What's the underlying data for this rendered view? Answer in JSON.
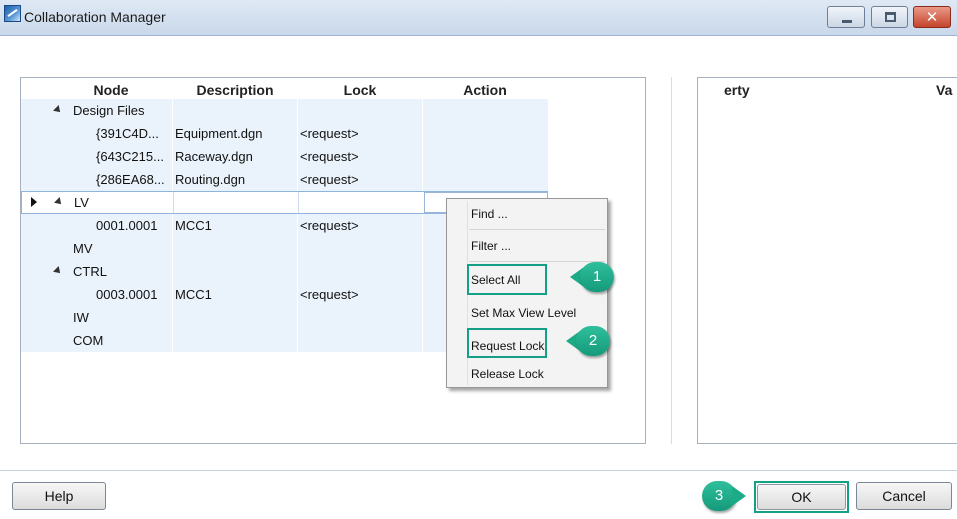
{
  "window": {
    "title": "Collaboration Manager",
    "close_glyph": "✕"
  },
  "grid": {
    "columns": [
      "Node",
      "Description",
      "Lock",
      "Action"
    ],
    "rows": [
      {
        "node": "Design Files",
        "description": "",
        "lock": ""
      },
      {
        "node": "{391C4D...",
        "description": "Equipment.dgn",
        "lock": "<request>"
      },
      {
        "node": "{643C215...",
        "description": "Raceway.dgn",
        "lock": "<request>"
      },
      {
        "node": "{286EA68...",
        "description": "Routing.dgn",
        "lock": "<request>"
      },
      {
        "node": "LV",
        "description": "",
        "lock": ""
      },
      {
        "node": "0001.0001",
        "description": "MCC1",
        "lock": "<request>"
      },
      {
        "node": "MV",
        "description": "",
        "lock": ""
      },
      {
        "node": "CTRL",
        "description": "",
        "lock": ""
      },
      {
        "node": "0003.0001",
        "description": "MCC1",
        "lock": "<request>"
      },
      {
        "node": "IW",
        "description": "",
        "lock": ""
      },
      {
        "node": "COM",
        "description": "",
        "lock": ""
      }
    ]
  },
  "properties": {
    "col_property": "erty",
    "col_value": "Va"
  },
  "context_menu": {
    "items": [
      "Find ...",
      "Filter ...",
      "Select All",
      "Set Max View Level",
      "Request Lock",
      "Release Lock"
    ]
  },
  "callouts": [
    "1",
    "2",
    "3"
  ],
  "buttons": {
    "help": "Help",
    "ok": "OK",
    "cancel": "Cancel"
  },
  "colors": {
    "highlight": "#14a085",
    "row_background": "#eaf2fb"
  }
}
